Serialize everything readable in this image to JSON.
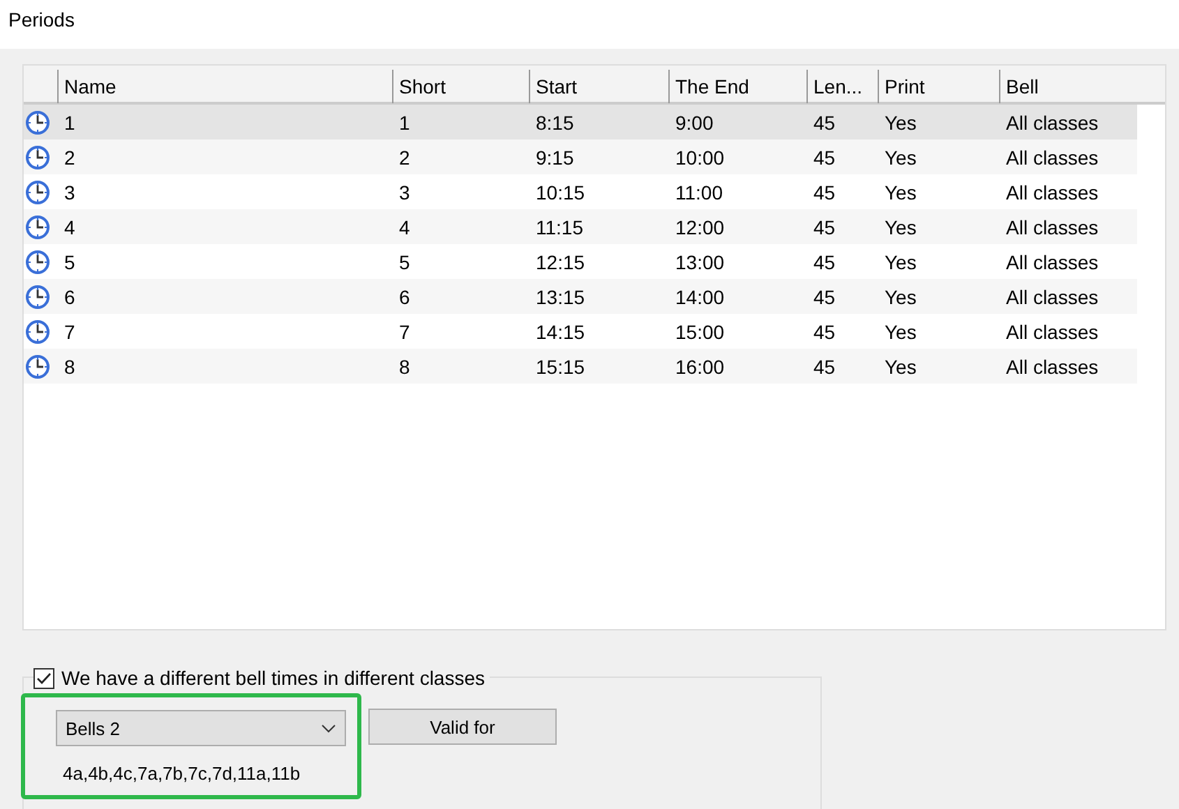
{
  "window": {
    "title": "Periods"
  },
  "table": {
    "columns": [
      "Name",
      "Short",
      "Start",
      "The End",
      "Len...",
      "Print",
      "Bell"
    ],
    "rows": [
      {
        "selected": true,
        "cells": [
          "1",
          "1",
          "8:15",
          "9:00",
          "45",
          "Yes",
          "All classes"
        ]
      },
      {
        "selected": false,
        "cells": [
          "2",
          "2",
          "9:15",
          "10:00",
          "45",
          "Yes",
          "All classes"
        ]
      },
      {
        "selected": false,
        "cells": [
          "3",
          "3",
          "10:15",
          "11:00",
          "45",
          "Yes",
          "All classes"
        ]
      },
      {
        "selected": false,
        "cells": [
          "4",
          "4",
          "11:15",
          "12:00",
          "45",
          "Yes",
          "All classes"
        ]
      },
      {
        "selected": false,
        "cells": [
          "5",
          "5",
          "12:15",
          "13:00",
          "45",
          "Yes",
          "All classes"
        ]
      },
      {
        "selected": false,
        "cells": [
          "6",
          "6",
          "13:15",
          "14:00",
          "45",
          "Yes",
          "All classes"
        ]
      },
      {
        "selected": false,
        "cells": [
          "7",
          "7",
          "14:15",
          "15:00",
          "45",
          "Yes",
          "All classes"
        ]
      },
      {
        "selected": false,
        "cells": [
          "8",
          "8",
          "15:15",
          "16:00",
          "45",
          "Yes",
          "All classes"
        ]
      }
    ]
  },
  "bells": {
    "checkbox": {
      "label": "We have a different bell times in different classes",
      "checked": true
    },
    "dropdown": {
      "value": "Bells 2"
    },
    "button": "Valid for",
    "classes": "4a,4b,4c,7a,7b,7c,7d,11a,11b"
  }
}
